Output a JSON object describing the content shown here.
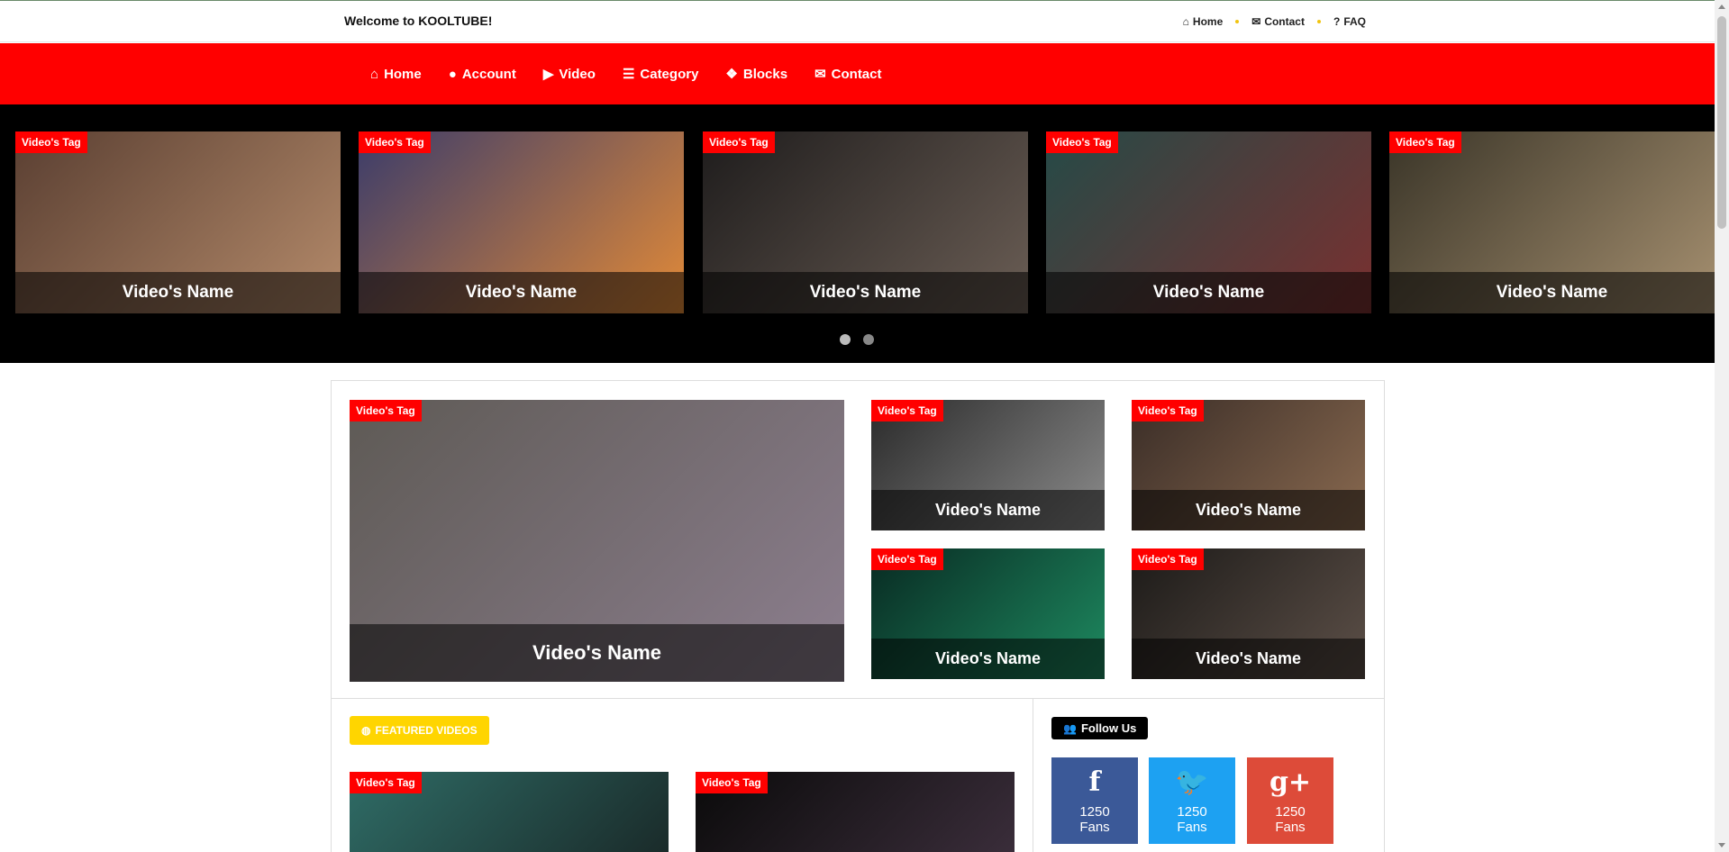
{
  "topbar": {
    "welcome": "Welcome to KOOLTUBE!",
    "links": [
      {
        "icon": "home-icon",
        "glyph": "⌂",
        "label": "Home"
      },
      {
        "icon": "comments-icon",
        "glyph": "✉",
        "label": "Contact"
      },
      {
        "icon": "question-icon",
        "glyph": "?",
        "label": "FAQ"
      }
    ]
  },
  "nav": {
    "items": [
      {
        "icon": "home-icon",
        "glyph": "⌂",
        "label": "Home"
      },
      {
        "icon": "user-icon",
        "glyph": "●",
        "label": "Account"
      },
      {
        "icon": "play-circle-icon",
        "glyph": "▶",
        "label": "Video"
      },
      {
        "icon": "list-icon",
        "glyph": "☰",
        "label": "Category"
      },
      {
        "icon": "cubes-icon",
        "glyph": "❖",
        "label": "Blocks"
      },
      {
        "icon": "envelope-icon",
        "glyph": "✉",
        "label": "Contact"
      }
    ]
  },
  "slider": {
    "cards": [
      {
        "tag": "Video's Tag",
        "name": "Video's Name",
        "c1": "#5a3f32",
        "c2": "#b48a6a"
      },
      {
        "tag": "Video's Tag",
        "name": "Video's Name",
        "c1": "#3b3c6a",
        "c2": "#e28a38"
      },
      {
        "tag": "Video's Tag",
        "name": "Video's Name",
        "c1": "#1e1c1c",
        "c2": "#6b5e55"
      },
      {
        "tag": "Video's Tag",
        "name": "Video's Name",
        "c1": "#254a47",
        "c2": "#7a3030"
      },
      {
        "tag": "Video's Tag",
        "name": "Video's Name",
        "c1": "#3a3528",
        "c2": "#a69070"
      }
    ],
    "dots": 2,
    "active_dot": 0
  },
  "grid": {
    "main": {
      "tag": "Video's Tag",
      "name": "Video's Name",
      "c1": "#5e5a55",
      "c2": "#8d7f8f"
    },
    "small": [
      {
        "tag": "Video's Tag",
        "name": "Video's Name",
        "c1": "#2a2a2a",
        "c2": "#8c8c8c"
      },
      {
        "tag": "Video's Tag",
        "name": "Video's Name",
        "c1": "#3a2d27",
        "c2": "#8a6a50"
      },
      {
        "tag": "Video's Tag",
        "name": "Video's Name",
        "c1": "#082a22",
        "c2": "#1e8a60"
      },
      {
        "tag": "Video's Tag",
        "name": "Video's Name",
        "c1": "#1c1a18",
        "c2": "#5d5048"
      }
    ]
  },
  "featured": {
    "label": "FEATURED VIDEOS",
    "icon": "globe-icon",
    "cards": [
      {
        "tag": "Video's Tag",
        "c1": "#2f6c66",
        "c2": "#1a2b2a"
      },
      {
        "tag": "Video's Tag",
        "c1": "#0a0a0a",
        "c2": "#3a2d3a"
      }
    ]
  },
  "follow": {
    "label": "Follow Us",
    "icon": "users-icon",
    "networks": [
      {
        "name": "facebook",
        "glyph": "f",
        "count": "1250",
        "unit": "Fans",
        "color": "#3b5998"
      },
      {
        "name": "twitter",
        "glyph": "🐦",
        "count": "1250",
        "unit": "Fans",
        "color": "#1da1f2"
      },
      {
        "name": "google-plus",
        "glyph": "g+",
        "count": "1250",
        "unit": "Fans",
        "color": "#dd4b39"
      }
    ]
  }
}
